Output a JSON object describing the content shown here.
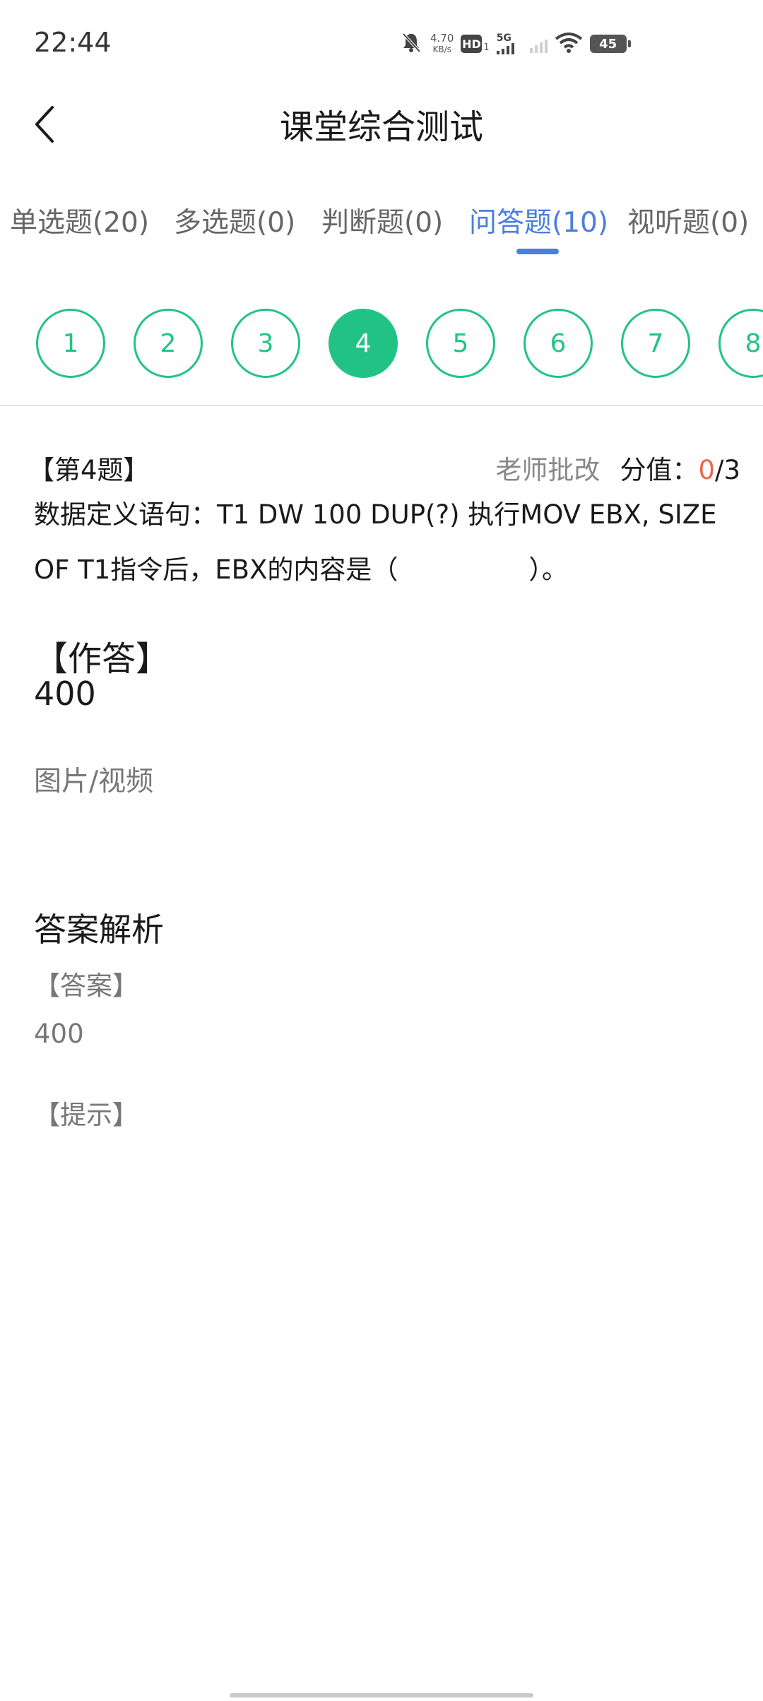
{
  "status_bar": {
    "time": "22:44",
    "net_speed_value": "4.70",
    "net_speed_unit": "KB/s",
    "hd_label": "HD",
    "hd_sub": "1",
    "network_type": "5G",
    "battery": "45"
  },
  "header": {
    "title": "课堂综合测试"
  },
  "tabs": [
    {
      "label": "单选题(20)",
      "active": false
    },
    {
      "label": "多选题(0)",
      "active": false
    },
    {
      "label": "判断题(0)",
      "active": false
    },
    {
      "label": "问答题(10)",
      "active": true
    },
    {
      "label": "视听题(0)",
      "active": false
    }
  ],
  "question_numbers": [
    "1",
    "2",
    "3",
    "4",
    "5",
    "6",
    "7",
    "8"
  ],
  "current_question": "4",
  "question": {
    "label": "【第4题】",
    "grading_mode": "老师批改",
    "score_label": "分值：",
    "score_obtained": "0",
    "score_sep": "/",
    "score_total": "3",
    "text_line1": "数据定义语句：T1 DW 100 DUP(?) 执行MOV EBX, SIZE",
    "text_line2": "OF T1指令后，EBX的内容是（　　　　　）。"
  },
  "answer": {
    "heading": "【作答】",
    "value": "400",
    "media_label": "图片/视频"
  },
  "analysis": {
    "heading": "答案解析",
    "key_label": "【答案】",
    "key_value": "400",
    "hint_label": "【提示】"
  },
  "colors": {
    "accent_green": "#21c384",
    "tab_active_blue": "#4a7ee0",
    "score_red": "#e86a4a"
  }
}
